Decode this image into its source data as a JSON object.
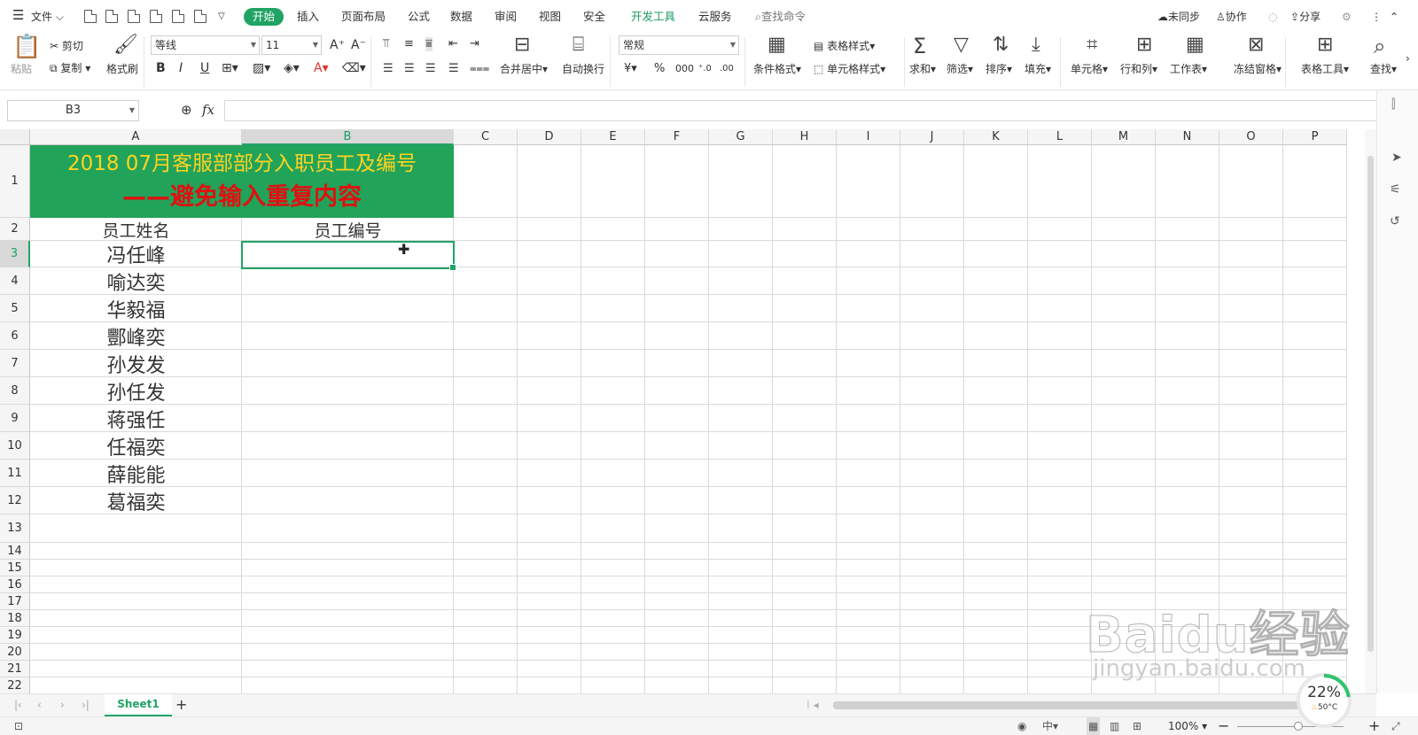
{
  "menubar": {
    "file_label": "文件",
    "tabs": [
      "开始",
      "插入",
      "页面布局",
      "公式",
      "数据",
      "审阅",
      "视图",
      "安全",
      "开发工具",
      "云服务"
    ],
    "search_label": "查找命令",
    "sync_label": "未同步",
    "collab_label": "协作",
    "share_label": "分享"
  },
  "ribbon": {
    "paste": "粘贴",
    "cut": "剪切",
    "copy": "复制",
    "format_painter": "格式刷",
    "font_name": "等线",
    "font_size": "11",
    "merge_center": "合并居中",
    "wrap_text": "自动换行",
    "number_format": "常规",
    "conditional_format": "条件格式",
    "table_style": "表格样式",
    "cell_style": "单元格样式",
    "sum": "求和",
    "filter": "筛选",
    "sort": "排序",
    "fill": "填充",
    "cell": "单元格",
    "row_col": "行和列",
    "worksheet": "工作表",
    "freeze": "冻结窗格",
    "table_tools": "表格工具",
    "find": "查找"
  },
  "formula_bar": {
    "name_box": "B3",
    "fx_label": "fx",
    "content": ""
  },
  "grid": {
    "columns": [
      "A",
      "B",
      "C",
      "D",
      "E",
      "F",
      "G",
      "H",
      "I",
      "J",
      "K",
      "L",
      "M",
      "N",
      "O",
      "P"
    ],
    "rows": [
      "1",
      "2",
      "3",
      "4",
      "5",
      "6",
      "7",
      "8",
      "9",
      "10",
      "11",
      "12",
      "13",
      "14",
      "15",
      "16",
      "17",
      "18",
      "19",
      "20",
      "21",
      "22"
    ],
    "selected_cell": "B3",
    "title_line1": "2018 07月客服部部分入职员工及编号",
    "title_line2": "——避免输入重复内容",
    "header_a": "员工姓名",
    "header_b": "员工编号",
    "names": [
      "冯任峰",
      "喻达奕",
      "华毅福",
      "酆峰奕",
      "孙发发",
      "孙任发",
      "蒋强任",
      "任福奕",
      "薛能能",
      "葛福奕"
    ]
  },
  "sheets": {
    "tabs": [
      "Sheet1"
    ],
    "active": "Sheet1"
  },
  "status": {
    "zoom": "100%"
  },
  "overlay": {
    "watermark_text": "Baidu经验",
    "watermark_url": "jingyan.baidu.com",
    "gauge_percent": "22%",
    "gauge_temp": "50°C"
  },
  "colors": {
    "accent": "#21a366",
    "title_bg": "#21a35a",
    "title_line1": "#ffd320",
    "title_line2": "#e01010"
  }
}
